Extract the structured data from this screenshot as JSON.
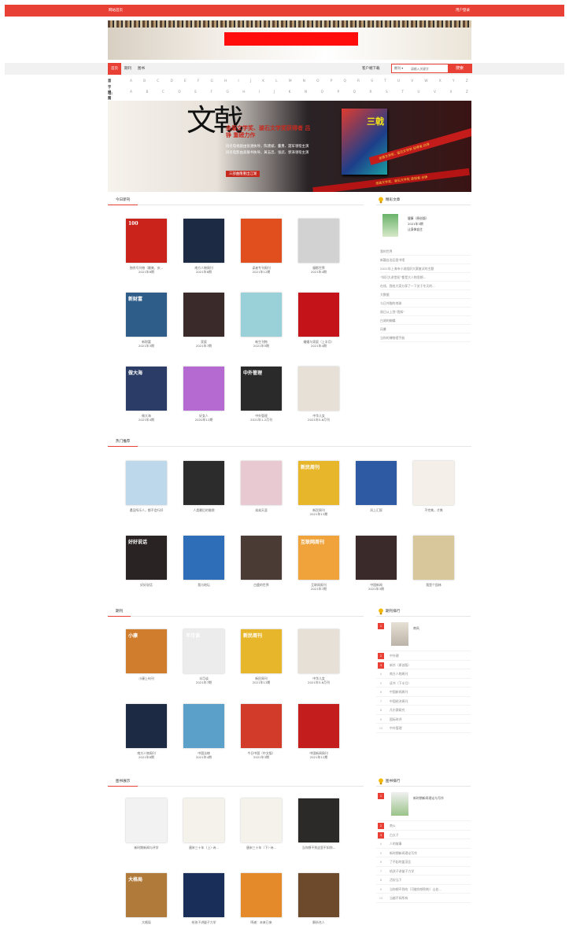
{
  "topbar": {
    "left": "网站首页",
    "right": "用户登录"
  },
  "nav": {
    "tabs": [
      "首页",
      "期刊",
      "图书"
    ],
    "client_download": "客户端下载"
  },
  "search": {
    "select": "期刊",
    "placeholder": "请输入关键字",
    "button": "搜索"
  },
  "index_rows": [
    {
      "label": "首字母:",
      "letters": [
        "A",
        "B",
        "C",
        "D",
        "E",
        "F",
        "G",
        "H",
        "I",
        "J",
        "K",
        "L",
        "M",
        "N",
        "O",
        "P",
        "Q",
        "R",
        "S",
        "T",
        "U",
        "V",
        "W",
        "X",
        "Y",
        "Z"
      ]
    },
    {
      "label": "中图法:",
      "letters": [
        "A",
        "B",
        "C",
        "D",
        "E",
        "F",
        "G",
        "H",
        "I",
        "J",
        "K",
        "N",
        "O",
        "P",
        "Q",
        "R",
        "S",
        "T",
        "U",
        "V",
        "X",
        "Z"
      ]
    }
  ],
  "hero": {
    "title_mark": "文戟",
    "headline": "金盾文学奖、骏石文学奖获得者 吕铮 重磅力作",
    "line1": "同名电视剧由张涵执导，陈建斌、董勇、聂军领衔主演",
    "line2": "同名电影由高群书执导，黄志忠、张武、郭涛领衔主演",
    "cta": "三部曲隆重出江湖",
    "book_title": "三戟",
    "tape": "金盾文学奖、骏石文学奖 获得者·吕铮"
  },
  "colors": {
    "accent": "#e94036"
  },
  "sections": {
    "today": {
      "title": "今日新刊",
      "books": [
        {
          "name": "独秀号刊物（最美、庆...",
          "issue": "2021年8期",
          "color": "#c9231b",
          "mark": "100"
        },
        {
          "name": "南方人物周刊",
          "issue": "2021年8期",
          "color": "#1c2a44",
          "mark": ""
        },
        {
          "name": "读者专刊周刊",
          "issue": "2021年12期",
          "color": "#e14f1f",
          "mark": ""
        },
        {
          "name": "摄影世界",
          "issue": "2021年4期",
          "color": "#d2d2d2",
          "mark": ""
        },
        {
          "name": "新财富",
          "issue": "2021年3期",
          "color": "#2f5d8a",
          "mark": "新财富"
        },
        {
          "name": "家庭",
          "issue": "2021年7期",
          "color": "#3b2a2a",
          "mark": ""
        },
        {
          "name": "新生刊物",
          "issue": "2021年5期",
          "color": "#9ad1d8",
          "mark": ""
        },
        {
          "name": "婚姻与家庭（上半月）",
          "issue": "2021年4期",
          "color": "#c4141a",
          "mark": ""
        },
        {
          "name": "做大海",
          "issue": "2021年4期",
          "color": "#2b3d66",
          "mark": "做大海"
        },
        {
          "name": "好女人",
          "issue": "2020年12期",
          "color": "#b56ad1",
          "mark": ""
        },
        {
          "name": "中外管理",
          "issue": "2021年1-2月刊",
          "color": "#2a2a2a",
          "mark": "中外管理"
        },
        {
          "name": "中华儿女",
          "issue": "2021年5-6月刊",
          "color": "#e6e0d7",
          "mark": ""
        }
      ]
    },
    "hot": {
      "title": "热门推荐",
      "books": [
        {
          "name": "遇见所乐人，都不会行好",
          "issue": "",
          "color": "#bcd8ea",
          "mark": ""
        },
        {
          "name": "人类最后的脑袋",
          "issue": "",
          "color": "#2c2c2c",
          "mark": ""
        },
        {
          "name": "弟弟天涯",
          "issue": "",
          "color": "#e8c9d2",
          "mark": ""
        },
        {
          "name": "新民周刊",
          "issue": "2021年13期",
          "color": "#e8b62a",
          "mark": "新民周刊"
        },
        {
          "name": "风上汇报",
          "issue": "",
          "color": "#2d5aa3",
          "mark": ""
        },
        {
          "name": "不完美，才美",
          "issue": "",
          "color": "#f4efe8",
          "mark": ""
        },
        {
          "name": "好好说话",
          "issue": "",
          "color": "#2a2323",
          "mark": "好好说话"
        },
        {
          "name": "我与地坛",
          "issue": "",
          "color": "#2e6eb8",
          "mark": ""
        },
        {
          "name": "白鹿的世界",
          "issue": "",
          "color": "#4a3c34",
          "mark": ""
        },
        {
          "name": "互联网周刊",
          "issue": "2021年7期",
          "color": "#f0a33a",
          "mark": "互联网周刊"
        },
        {
          "name": "中国新闻",
          "issue": "2021年3期",
          "color": "#3a2a2a",
          "mark": ""
        },
        {
          "name": "我是个园林",
          "issue": "",
          "color": "#d8c79a",
          "mark": ""
        }
      ]
    },
    "periodicals": {
      "title": "期刊",
      "books": [
        {
          "name": "小康上旬刊",
          "issue": "",
          "color": "#d07d2e",
          "mark": "小康"
        },
        {
          "name": "半月谈",
          "issue": "2021年7期",
          "color": "#ececec",
          "mark": "半月谈"
        },
        {
          "name": "新民周刊",
          "issue": "2021年13期",
          "color": "#e8b62a",
          "mark": "新民周刊"
        },
        {
          "name": "中华儿女",
          "issue": "2021年5-6月刊",
          "color": "#e6e0d7",
          "mark": ""
        },
        {
          "name": "南方人物周刊",
          "issue": "2021年8期",
          "color": "#1c2a44",
          "mark": ""
        },
        {
          "name": "中国法律",
          "issue": "2021年4期",
          "color": "#5aa0c8",
          "mark": ""
        },
        {
          "name": "今日中国（中文版）",
          "issue": "2021年3期",
          "color": "#d23a2a",
          "mark": ""
        },
        {
          "name": "中国新闻周刊",
          "issue": "2021年12期",
          "color": "#c41d1d",
          "mark": ""
        }
      ]
    },
    "books": {
      "title": "图书展示",
      "books": [
        {
          "name": "新时期新闻与评学",
          "issue": "",
          "color": "#f2f2f2",
          "mark": ""
        },
        {
          "name": "唐宋三十年（上）·诗...",
          "issue": "",
          "color": "#f5f2ec",
          "mark": ""
        },
        {
          "name": "唐宋三十年（下）·诗...",
          "issue": "",
          "color": "#f5f2ec",
          "mark": ""
        },
        {
          "name": "当你想不到这里不如你...",
          "issue": "",
          "color": "#2c2a28",
          "mark": ""
        },
        {
          "name": "大格局",
          "issue": "",
          "color": "#b07a3a",
          "mark": "大格局"
        },
        {
          "name": "给孩子讲量子力学",
          "issue": "",
          "color": "#1a2e5a",
          "mark": ""
        },
        {
          "name": "鸣谢：未来已来",
          "issue": "",
          "color": "#e48a2a",
          "mark": ""
        },
        {
          "name": "解析名人",
          "issue": "",
          "color": "#6e4a2c",
          "mark": ""
        }
      ]
    }
  },
  "sidebar": {
    "recommend": {
      "title": "精彩文章",
      "featured": {
        "name": "健康（原创版）",
        "issue": "2021年3期",
        "extra": "让身体自主"
      },
      "items": [
        "我的世界",
        "新疆自治区图书馆",
        "2021年上海市小说组织大赛复试的主题",
        "“知识大讲堂初”都是大人物思想...",
        "在线、我给大家分享了一下关于冬天的...",
        "大数据",
        "与日共融的地球",
        "周日从上到“我知”",
        "白湖的蝴蝶",
        "风暴",
        "当你的博物馆手册"
      ]
    },
    "ranking": {
      "title": "期刊排行",
      "top": {
        "no": "1",
        "name": "南风"
      },
      "rows": [
        {
          "no": "2",
          "name": "中外建",
          "red": true
        },
        {
          "no": "3",
          "name": "新华（原创版）",
          "red": true
        },
        {
          "no": "4",
          "name": "南方人物周刊",
          "red": false
        },
        {
          "no": "5",
          "name": "读书（下半月）",
          "red": false
        },
        {
          "no": "6",
          "name": "中国新闻周刊",
          "red": false
        },
        {
          "no": "7",
          "name": "中国经济周刊",
          "red": false
        },
        {
          "no": "8",
          "name": "凡尔赛研究",
          "red": false
        },
        {
          "no": "9",
          "name": "国际时评",
          "red": false
        },
        {
          "no": "10",
          "name": "中外管理",
          "red": false
        }
      ]
    },
    "book_ranking": {
      "title": "图书排行",
      "top": {
        "no": "1",
        "name": "新时期新闻理论与写作"
      },
      "rows": [
        {
          "no": "2",
          "name": "南火",
          "red": true
        },
        {
          "no": "3",
          "name": "白太子",
          "red": true
        },
        {
          "no": "4",
          "name": "人的故事",
          "red": false
        },
        {
          "no": "5",
          "name": "新时期新闻理论写作",
          "red": false
        },
        {
          "no": "6",
          "name": "了不起的盖茨比",
          "red": false
        },
        {
          "no": "7",
          "name": "给孩子讲量子力学",
          "red": false
        },
        {
          "no": "8",
          "name": "活好当下",
          "red": false
        },
        {
          "no": "9",
          "name": "当你想不到的（可能你想到的）山花...",
          "red": false
        },
        {
          "no": "10",
          "name": "当越不如所有",
          "red": false
        }
      ]
    }
  }
}
